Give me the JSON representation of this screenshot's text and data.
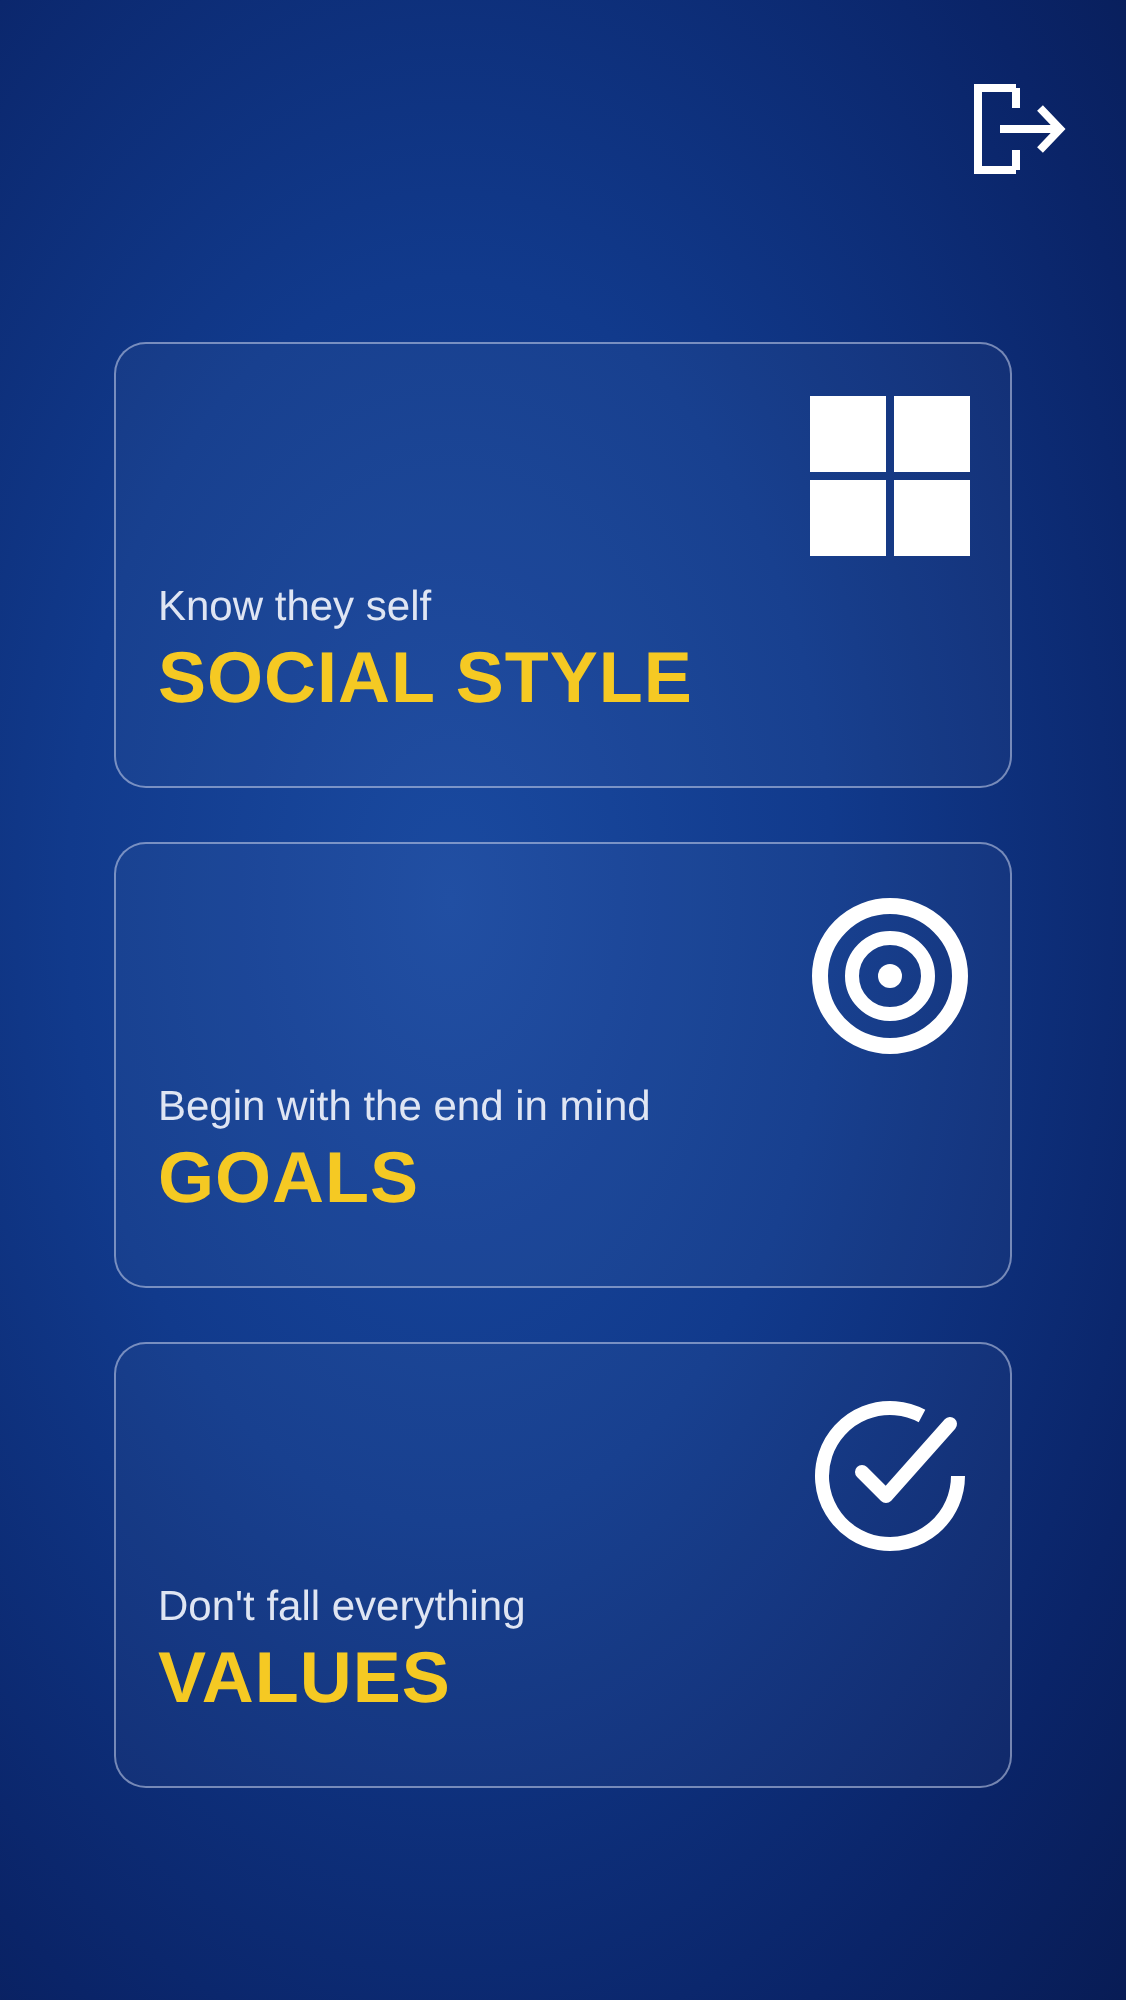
{
  "cards": [
    {
      "kind": "grid",
      "subtitle": "Know they self",
      "title": "SOCIAL STYLE"
    },
    {
      "kind": "target",
      "subtitle": "Begin with the end in mind",
      "title": "GOALS"
    },
    {
      "kind": "check",
      "subtitle": "Don't fall everything",
      "title": "VALUES"
    }
  ]
}
